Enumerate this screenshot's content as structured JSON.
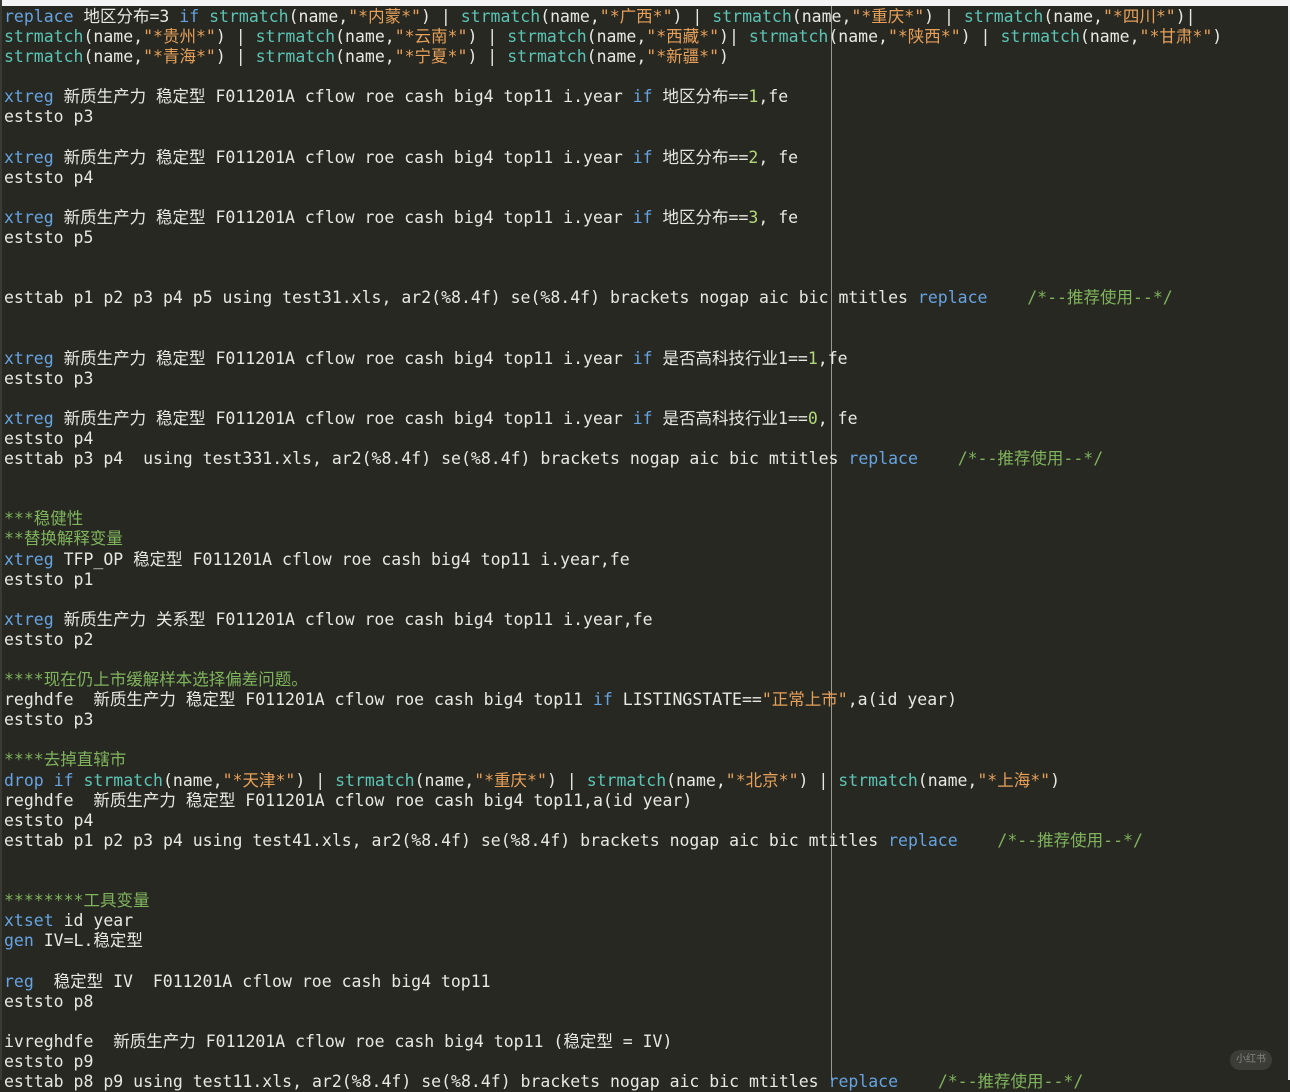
{
  "editor": {
    "lines": [
      [
        [
          "k",
          "replace"
        ],
        [
          "t",
          " 地区分布=3 "
        ],
        [
          "k",
          "if"
        ],
        [
          "t",
          " "
        ],
        [
          "f",
          "strmatch"
        ],
        [
          "t",
          "(name,"
        ],
        [
          "s",
          "\"*内蒙*\""
        ],
        [
          "t",
          ") | "
        ],
        [
          "f",
          "strmatch"
        ],
        [
          "t",
          "(name,"
        ],
        [
          "s",
          "\"*广西*\""
        ],
        [
          "t",
          ") | "
        ],
        [
          "f",
          "strmatch"
        ],
        [
          "t",
          "(name,"
        ],
        [
          "s",
          "\"*重庆*\""
        ],
        [
          "t",
          ") | "
        ],
        [
          "f",
          "strmatch"
        ],
        [
          "t",
          "(name,"
        ],
        [
          "s",
          "\"*四川*\""
        ],
        [
          "t",
          ")|"
        ]
      ],
      [
        [
          "f",
          "strmatch"
        ],
        [
          "t",
          "(name,"
        ],
        [
          "s",
          "\"*贵州*\""
        ],
        [
          "t",
          ") | "
        ],
        [
          "f",
          "strmatch"
        ],
        [
          "t",
          "(name,"
        ],
        [
          "s",
          "\"*云南*\""
        ],
        [
          "t",
          ") | "
        ],
        [
          "f",
          "strmatch"
        ],
        [
          "t",
          "(name,"
        ],
        [
          "s",
          "\"*西藏*\""
        ],
        [
          "t",
          ")| "
        ],
        [
          "f",
          "strmatch"
        ],
        [
          "t",
          "(name,"
        ],
        [
          "s",
          "\"*陕西*\""
        ],
        [
          "t",
          ") | "
        ],
        [
          "f",
          "strmatch"
        ],
        [
          "t",
          "(name,"
        ],
        [
          "s",
          "\"*甘肃*\""
        ],
        [
          "t",
          ")"
        ]
      ],
      [
        [
          "f",
          "strmatch"
        ],
        [
          "t",
          "(name,"
        ],
        [
          "s",
          "\"*青海*\""
        ],
        [
          "t",
          ") | "
        ],
        [
          "f",
          "strmatch"
        ],
        [
          "t",
          "(name,"
        ],
        [
          "s",
          "\"*宁夏*\""
        ],
        [
          "t",
          ") | "
        ],
        [
          "f",
          "strmatch"
        ],
        [
          "t",
          "(name,"
        ],
        [
          "s",
          "\"*新疆*\""
        ],
        [
          "t",
          ")"
        ]
      ],
      [],
      [
        [
          "k",
          "xtreg"
        ],
        [
          "t",
          " 新质生产力 稳定型 F011201A cflow roe cash big4 top11 i.year "
        ],
        [
          "k",
          "if"
        ],
        [
          "t",
          " 地区分布=="
        ],
        [
          "n",
          "1"
        ],
        [
          "t",
          ",fe"
        ]
      ],
      [
        [
          "t",
          "eststo p3"
        ]
      ],
      [],
      [
        [
          "k",
          "xtreg"
        ],
        [
          "t",
          " 新质生产力 稳定型 F011201A cflow roe cash big4 top11 i.year "
        ],
        [
          "k",
          "if"
        ],
        [
          "t",
          " 地区分布=="
        ],
        [
          "n",
          "2"
        ],
        [
          "t",
          ", fe"
        ]
      ],
      [
        [
          "t",
          "eststo p4"
        ]
      ],
      [],
      [
        [
          "k",
          "xtreg"
        ],
        [
          "t",
          " 新质生产力 稳定型 F011201A cflow roe cash big4 top11 i.year "
        ],
        [
          "k",
          "if"
        ],
        [
          "t",
          " 地区分布=="
        ],
        [
          "n",
          "3"
        ],
        [
          "t",
          ", fe"
        ]
      ],
      [
        [
          "t",
          "eststo p5"
        ]
      ],
      [],
      [],
      [
        [
          "t",
          "esttab p1 p2 p3 p4 p5 using test31.xls, ar2(%8.4f) se(%8.4f) brackets nogap aic bic mtitles "
        ],
        [
          "k",
          "replace"
        ],
        [
          "t",
          "    "
        ],
        [
          "c",
          "/*--推荐使用--*/"
        ]
      ],
      [],
      [],
      [
        [
          "k",
          "xtreg"
        ],
        [
          "t",
          " 新质生产力 稳定型 F011201A cflow roe cash big4 top11 i.year "
        ],
        [
          "k",
          "if"
        ],
        [
          "t",
          " 是否高科技行业1=="
        ],
        [
          "n",
          "1"
        ],
        [
          "t",
          ",fe"
        ]
      ],
      [
        [
          "t",
          "eststo p3"
        ]
      ],
      [],
      [
        [
          "k",
          "xtreg"
        ],
        [
          "t",
          " 新质生产力 稳定型 F011201A cflow roe cash big4 top11 i.year "
        ],
        [
          "k",
          "if"
        ],
        [
          "t",
          " 是否高科技行业1=="
        ],
        [
          "n",
          "0"
        ],
        [
          "t",
          ", fe"
        ]
      ],
      [
        [
          "t",
          "eststo p4"
        ]
      ],
      [
        [
          "t",
          "esttab p3 p4  using test331.xls, ar2(%8.4f) se(%8.4f) brackets nogap aic bic mtitles "
        ],
        [
          "k",
          "replace"
        ],
        [
          "t",
          "    "
        ],
        [
          "c",
          "/*--推荐使用--*/"
        ]
      ],
      [],
      [],
      [
        [
          "c",
          "***稳健性"
        ]
      ],
      [
        [
          "c",
          "**替换解释变量"
        ]
      ],
      [
        [
          "k",
          "xtreg"
        ],
        [
          "t",
          " TFP_OP 稳定型 F011201A cflow roe cash big4 top11 i.year,fe"
        ]
      ],
      [
        [
          "t",
          "eststo p1"
        ]
      ],
      [],
      [
        [
          "k",
          "xtreg"
        ],
        [
          "t",
          " 新质生产力 关系型 F011201A cflow roe cash big4 top11 i.year,fe"
        ]
      ],
      [
        [
          "t",
          "eststo p2"
        ]
      ],
      [],
      [
        [
          "c",
          "****现在仍上市缓解样本选择偏差问题。"
        ]
      ],
      [
        [
          "t",
          "reghdfe  新质生产力 稳定型 F011201A cflow roe cash big4 top11 "
        ],
        [
          "k",
          "if"
        ],
        [
          "t",
          " LISTINGSTATE=="
        ],
        [
          "s",
          "\"正常上市\""
        ],
        [
          "t",
          ",a(id year)"
        ]
      ],
      [
        [
          "t",
          "eststo p3"
        ]
      ],
      [],
      [
        [
          "c",
          "****去掉直辖市"
        ]
      ],
      [
        [
          "k",
          "drop"
        ],
        [
          "t",
          " "
        ],
        [
          "k",
          "if"
        ],
        [
          "t",
          " "
        ],
        [
          "f",
          "strmatch"
        ],
        [
          "t",
          "(name,"
        ],
        [
          "s",
          "\"*天津*\""
        ],
        [
          "t",
          ") | "
        ],
        [
          "f",
          "strmatch"
        ],
        [
          "t",
          "(name,"
        ],
        [
          "s",
          "\"*重庆*\""
        ],
        [
          "t",
          ") | "
        ],
        [
          "f",
          "strmatch"
        ],
        [
          "t",
          "(name,"
        ],
        [
          "s",
          "\"*北京*\""
        ],
        [
          "t",
          ") | "
        ],
        [
          "f",
          "strmatch"
        ],
        [
          "t",
          "(name,"
        ],
        [
          "s",
          "\"*上海*\""
        ],
        [
          "t",
          ")"
        ]
      ],
      [
        [
          "t",
          "reghdfe  新质生产力 稳定型 F011201A cflow roe cash big4 top11,a(id year)"
        ]
      ],
      [
        [
          "t",
          "eststo p4"
        ]
      ],
      [
        [
          "t",
          "esttab p1 p2 p3 p4 using test41.xls, ar2(%8.4f) se(%8.4f) brackets nogap aic bic mtitles "
        ],
        [
          "k",
          "replace"
        ],
        [
          "t",
          "    "
        ],
        [
          "c",
          "/*--推荐使用--*/"
        ]
      ],
      [],
      [],
      [
        [
          "c",
          "********工具变量"
        ]
      ],
      [
        [
          "k",
          "xtset"
        ],
        [
          "t",
          " id year"
        ]
      ],
      [
        [
          "k",
          "gen"
        ],
        [
          "t",
          " IV=L.稳定型"
        ]
      ],
      [],
      [
        [
          "k",
          "reg"
        ],
        [
          "t",
          "  稳定型 IV  F011201A cflow roe cash big4 top11"
        ]
      ],
      [
        [
          "t",
          "eststo p8"
        ]
      ],
      [],
      [
        [
          "t",
          "ivreghdfe  新质生产力 F011201A cflow roe cash big4 top11 (稳定型 = IV)"
        ]
      ],
      [
        [
          "t",
          "eststo p9"
        ]
      ],
      [
        [
          "t",
          "esttab p8 p9 using test11.xls, ar2(%8.4f) se(%8.4f) brackets nogap aic bic mtitles "
        ],
        [
          "k",
          "replace"
        ],
        [
          "t",
          "    "
        ],
        [
          "c",
          "/*--推荐使用--*/"
        ]
      ]
    ]
  },
  "colors": {
    "background": "#272822",
    "keyword": "#66a3e0",
    "function": "#5cc4b4",
    "string": "#e6a05a",
    "comment": "#7fb35c",
    "number": "#b3d97a",
    "text": "#e8e8e2"
  },
  "watermark": {
    "text": "小红书"
  }
}
